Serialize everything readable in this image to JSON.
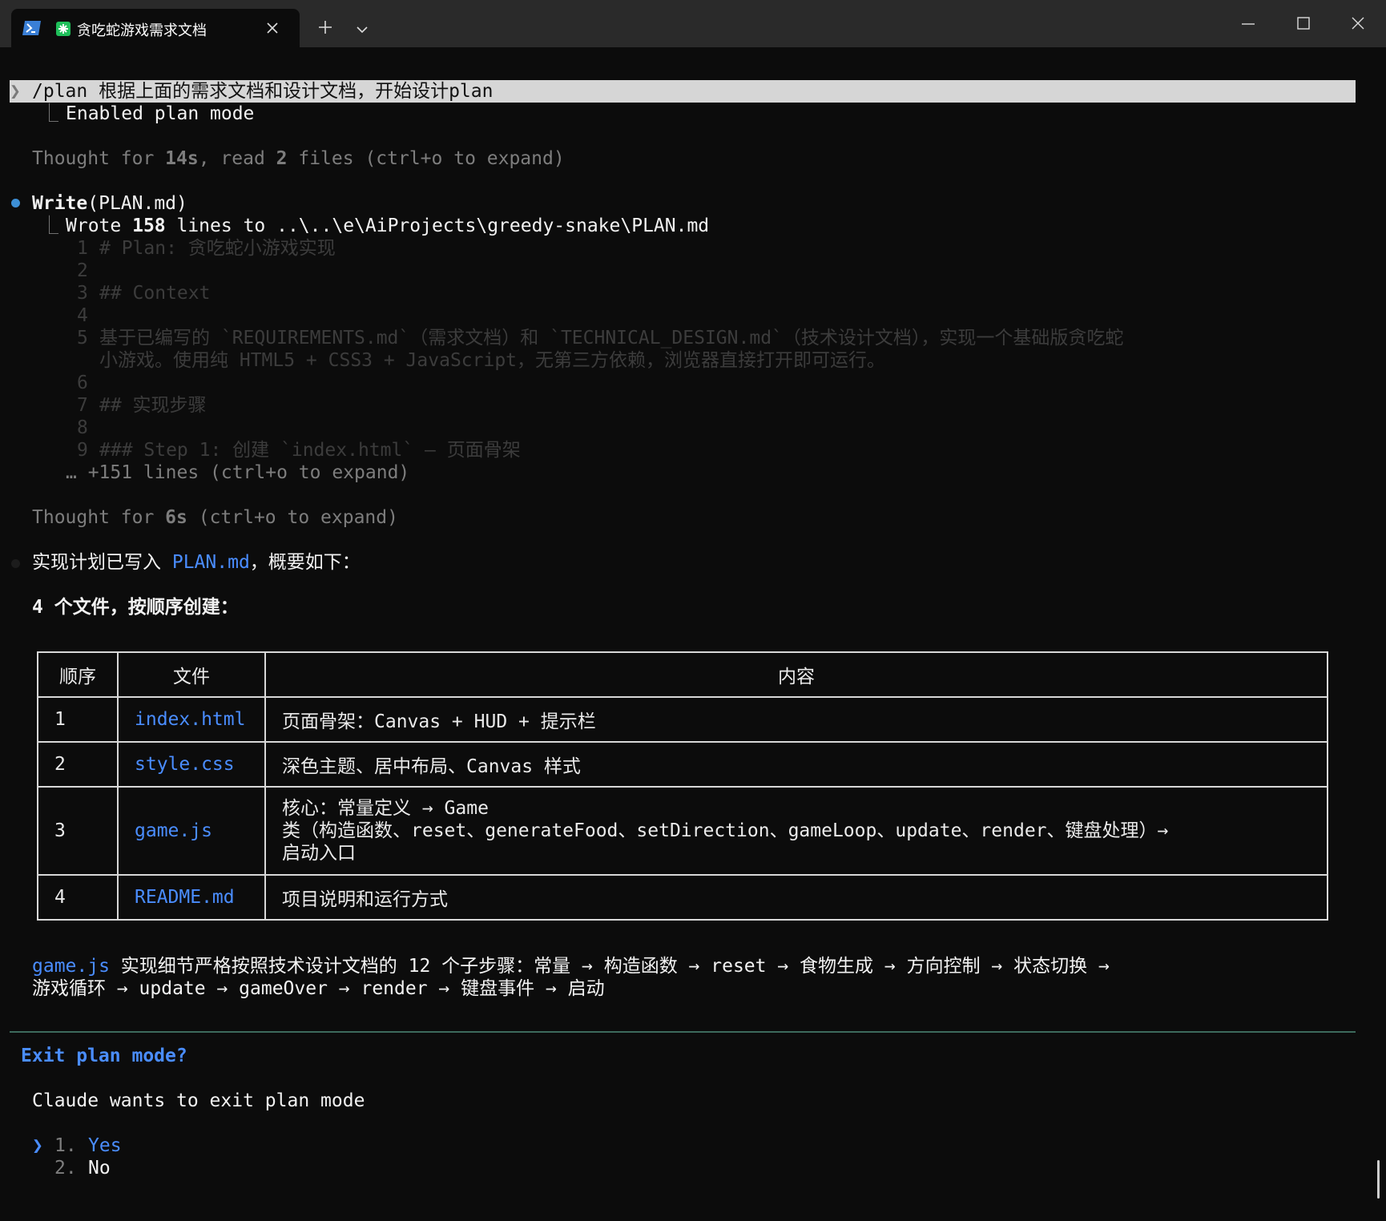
{
  "window": {
    "tab_title": "贪吃蛇游戏需求文档",
    "icons": {
      "powershell": "powershell-icon",
      "app": "app-icon",
      "tab_close": "close-icon",
      "new_tab": "plus-icon",
      "dropdown": "chevron-down-icon",
      "minimize": "minimize-icon",
      "maximize": "maximize-icon",
      "close": "close-icon"
    }
  },
  "terminal": {
    "prompt_marker": "❯",
    "prompt_command": "/plan 根据上面的需求文档和设计文档，开始设计plan",
    "tree_glyph": "⎿",
    "enabled_plan_mode": "Enabled plan mode",
    "thought_1": {
      "prefix": "Thought for ",
      "duration": "14s",
      "middle": ", read ",
      "files": "2",
      "suffix": " files (ctrl+o to expand)"
    },
    "write_call": {
      "name": "Write",
      "arg": "(PLAN.md)"
    },
    "write_result": {
      "prefix": "Wrote ",
      "count": "158",
      "suffix": " lines to ..\\..\\e\\AiProjects\\greedy-snake\\PLAN.md"
    },
    "preview_lines": [
      {
        "n": "1",
        "text": "# Plan: 贪吃蛇小游戏实现"
      },
      {
        "n": "2",
        "text": ""
      },
      {
        "n": "3",
        "text": "## Context"
      },
      {
        "n": "4",
        "text": ""
      },
      {
        "n": "5",
        "text": "基于已编写的 `REQUIREMENTS.md`（需求文档）和 `TECHNICAL_DESIGN.md`（技术设计文档），实现一个基础版贪吃蛇"
      },
      {
        "n": "",
        "text": "小游戏。使用纯 HTML5 + CSS3 + JavaScript，无第三方依赖，浏览器直接打开即可运行。"
      },
      {
        "n": "6",
        "text": ""
      },
      {
        "n": "7",
        "text": "## 实现步骤"
      },
      {
        "n": "8",
        "text": ""
      },
      {
        "n": "9",
        "text": "### Step 1: 创建 `index.html` — 页面骨架"
      }
    ],
    "more_lines": "… +151 lines (ctrl+o to expand)",
    "thought_2": {
      "prefix": "Thought for ",
      "duration": "6s",
      "suffix": " (ctrl+o to expand)"
    },
    "summary": {
      "prefix": "实现计划已写入 ",
      "link": "PLAN.md",
      "suffix": "，概要如下："
    },
    "files_heading": "4 个文件，按顺序创建：",
    "table": {
      "headers": [
        "顺序",
        "文件",
        "内容"
      ],
      "rows": [
        {
          "idx": "1",
          "file": "index.html",
          "content": [
            "页面骨架：Canvas + HUD + 提示栏"
          ]
        },
        {
          "idx": "2",
          "file": "style.css",
          "content": [
            "深色主题、居中布局、Canvas 样式"
          ]
        },
        {
          "idx": "3",
          "file": "game.js",
          "content": [
            "核心：常量定义 → Game",
            "类（构造函数、reset、generateFood、setDirection、gameLoop、update、render、键盘处理）→",
            "启动入口"
          ]
        },
        {
          "idx": "4",
          "file": "README.md",
          "content": [
            "项目说明和运行方式"
          ]
        }
      ]
    },
    "detail": {
      "link": "game.js",
      "line1": " 实现细节严格按照技术设计文档的 12 个子步骤：常量 → 构造函数 → reset → 食物生成 → 方向控制 → 状态切换 →",
      "line2": "游戏循环 → update → gameOver → render → 键盘事件 → 启动"
    },
    "exit_dialog": {
      "title": "Exit plan mode?",
      "message": "Claude wants to exit plan mode",
      "cursor": "❯",
      "options": [
        {
          "num": "1.",
          "label": "Yes",
          "selected": true
        },
        {
          "num": "2.",
          "label": "No",
          "selected": false
        }
      ]
    }
  },
  "colors": {
    "background": "#0c0c0c",
    "accent_blue": "#4a8dff",
    "tool_bullet": "#3d8fd6",
    "rule": "#3d6a5c"
  }
}
